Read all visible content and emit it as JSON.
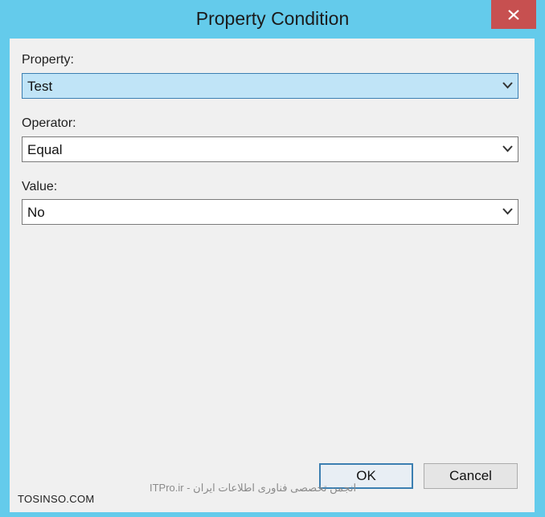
{
  "window": {
    "title": "Property Condition",
    "close_icon": "close-icon"
  },
  "fields": [
    {
      "label": "Property:",
      "value": "Test"
    },
    {
      "label": "Operator:",
      "value": "Equal"
    },
    {
      "label": "Value:",
      "value": "No"
    }
  ],
  "buttons": {
    "ok": "OK",
    "cancel": "Cancel"
  },
  "watermark": {
    "site": "TOSINSO.COM",
    "text": "ITPro.ir - انجمن تخصصی فناوری اطلاعات ایران"
  },
  "colors": {
    "title_bar": "#64cbeb",
    "close_button": "#c75050",
    "selected_field": "#c0e4f7"
  }
}
